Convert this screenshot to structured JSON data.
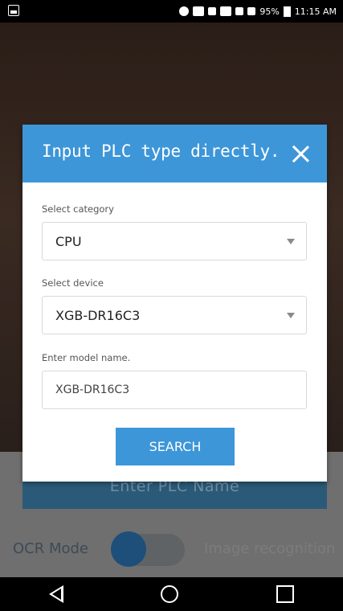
{
  "status_bar": {
    "battery_percent": "95%",
    "time": "11:15 AM"
  },
  "background": {
    "plc_name_button": "Enter PLC Name",
    "ocr_mode_label": "OCR Mode",
    "image_recognition_label": "Image recognition",
    "mode_toggle_on": false
  },
  "dialog": {
    "title": "Input PLC type directly.",
    "category_label": "Select category",
    "category_value": "CPU",
    "device_label": "Select device",
    "device_value": "XGB-DR16C3",
    "model_label": "Enter model name.",
    "model_value": "XGB-DR16C3",
    "search_button": "SEARCH"
  },
  "colors": {
    "accent": "#3d96d8",
    "plc_button": "#2b5a78"
  }
}
